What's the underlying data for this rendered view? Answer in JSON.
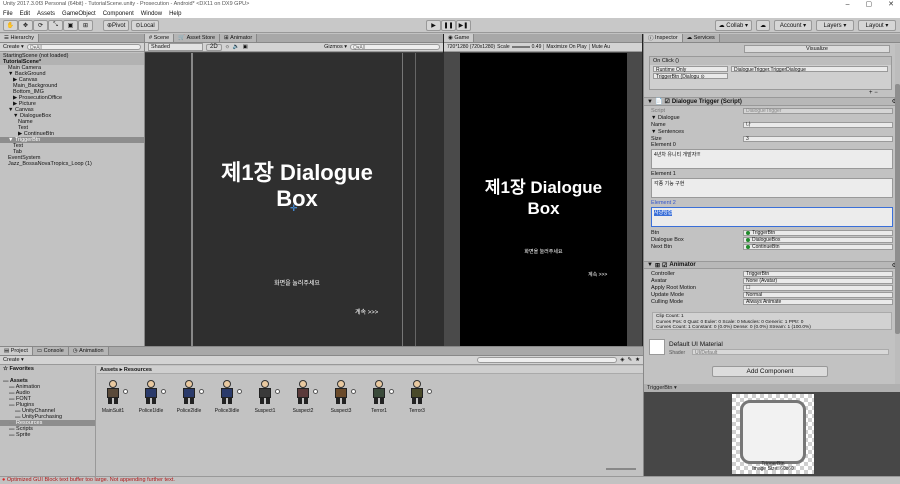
{
  "window": {
    "title": "Unity 2017.3.0f3 Personal (64bit) - TutorialScene.unity - Prosecution - Android* <DX11 on DX9 GPU>",
    "controls": [
      "–",
      "▢",
      "✕"
    ]
  },
  "menu": [
    "File",
    "Edit",
    "Assets",
    "GameObject",
    "Component",
    "Window",
    "Help"
  ],
  "toolbar": {
    "pivot": "Pivot",
    "local": "Local",
    "collab": "Collab ▾",
    "account": "Account ▾",
    "layers": "Layers ▾",
    "layout": "Layout ▾"
  },
  "hierarchy": {
    "tab": "Hierarchy",
    "create": "Create ▾",
    "search_placeholder": "Q▾All",
    "items": [
      {
        "label": "StartingScene (not loaded)",
        "indent": 0,
        "scene": true
      },
      {
        "label": "TutorialScene*",
        "indent": 0,
        "scene": true,
        "bold": true
      },
      {
        "label": "Main Camera",
        "indent": 1
      },
      {
        "label": "▼ BackGround",
        "indent": 1
      },
      {
        "label": "▶ Canvas",
        "indent": 2
      },
      {
        "label": "Main_Background",
        "indent": 2
      },
      {
        "label": "Bottom_IMG",
        "indent": 2
      },
      {
        "label": "▶ ProsecutionOffice",
        "indent": 2
      },
      {
        "label": "▶ Picture",
        "indent": 2
      },
      {
        "label": "▼ Canvas",
        "indent": 1
      },
      {
        "label": "▼ DialogueBox",
        "indent": 2
      },
      {
        "label": "Name",
        "indent": 3
      },
      {
        "label": "Text",
        "indent": 3
      },
      {
        "label": "▶ ContinueBtn",
        "indent": 3
      },
      {
        "label": "▼ TriggerBtn",
        "indent": 1,
        "selected": true
      },
      {
        "label": "Text",
        "indent": 2
      },
      {
        "label": "Tab",
        "indent": 2
      },
      {
        "label": "EventSystem",
        "indent": 1
      },
      {
        "label": "Jazz_BossaNovaTropics_Loop (1)",
        "indent": 1
      }
    ]
  },
  "scene": {
    "tabs": [
      "Scene",
      "Asset Store",
      "Animator"
    ],
    "shaded": "Shaded",
    "mode2d": "2D",
    "gizmos": "Gizmos ▾",
    "search": "Q▾All",
    "title_line1": "제1장 Dialogue",
    "title_line2": "Box",
    "prompt": "화면을 눌러주세요",
    "continue": "계속 >>>"
  },
  "game": {
    "tab": "Game",
    "resolution": "720*1280 (720x1280)",
    "scale_label": "Scale",
    "scale_value": "0.49",
    "maximize": "Maximize On Play",
    "mute": "Mute Au",
    "title_line1": "제1장 Dialogue",
    "title_line2": "Box",
    "prompt": "화면을 눌러주세요",
    "continue": "계속 >>>"
  },
  "project": {
    "tabs": [
      "Project",
      "Console",
      "Animation"
    ],
    "create": "Create ▾",
    "favorites": "Favorites",
    "tree": [
      {
        "label": "Assets",
        "indent": 0,
        "bold": true
      },
      {
        "label": "Animation",
        "indent": 1
      },
      {
        "label": "Audio",
        "indent": 1
      },
      {
        "label": "FONT",
        "indent": 1
      },
      {
        "label": "Plugins",
        "indent": 1
      },
      {
        "label": "UnityChannel",
        "indent": 2
      },
      {
        "label": "UnityPurchasing",
        "indent": 2
      },
      {
        "label": "Resources",
        "indent": 1,
        "selected": true
      },
      {
        "label": "Scripts",
        "indent": 1
      },
      {
        "label": "Sprite",
        "indent": 1
      }
    ],
    "breadcrumb": "Assets ▸ Resources",
    "assets": [
      "MainSuit1",
      "Police1Idle",
      "Police2Idle",
      "Police3Idle",
      "Suspect1",
      "Suspect2",
      "Suspect3",
      "Terror1",
      "Terror3"
    ]
  },
  "inspector": {
    "tabs": [
      "Inspector",
      "Services"
    ],
    "visualize": "Visualize",
    "onclick": "On Click ()",
    "runtime": "Runtime Only",
    "function": "DialogueTrigger.TriggerDialogue",
    "target": "TriggerBtn (Dialogu ⊙",
    "component_title": "Dialogue Trigger (Script)",
    "rows": [
      {
        "label": "Script",
        "value": "DialogueTrigger",
        "grey": true
      },
      {
        "label": "▼ Dialogue",
        "value": "",
        "nofield": true
      },
      {
        "label": "Name",
        "value": "나"
      },
      {
        "label": "▼ Sentences",
        "value": "",
        "nofield": true
      },
      {
        "label": "Size",
        "value": "3"
      }
    ],
    "elements": [
      {
        "label": "Element 0",
        "text": "4년차 유니티 개발자!!!"
      },
      {
        "label": "Element 1",
        "text": "각종 기능 구현"
      },
      {
        "label": "Element 2",
        "text": "사냥당함",
        "active": true
      }
    ],
    "refs": [
      {
        "label": "Btn",
        "value": "TriggerBtn"
      },
      {
        "label": "Dialogue Box",
        "value": "DialogueBox"
      },
      {
        "label": "Next Btn",
        "value": "ContinueBtn"
      }
    ],
    "animator_title": "Animator",
    "animator_rows": [
      {
        "label": "Controller",
        "value": "TriggerBtn"
      },
      {
        "label": "Avatar",
        "value": "None (Avatar)"
      },
      {
        "label": "Apply Root Motion",
        "value": "☐"
      },
      {
        "label": "Update Mode",
        "value": "Normal"
      },
      {
        "label": "Culling Mode",
        "value": "Always Animate"
      }
    ],
    "clip_info": [
      "Clip Count: 1",
      "Curves Pos: 0 Quat: 0 Euler: 0 Scale: 0 Muscles: 0 Generic: 1 PPtr: 0",
      "Curves Count: 1 Constant: 0 (0.0%) Dense: 0 (0.0%) Stream: 1 (100.0%)"
    ],
    "material": "Default UI Material",
    "shader_label": "Shader",
    "shader_value": "UI/Default",
    "add_component": "Add Component",
    "preview_tab": "TriggerBtn ▾",
    "preview_caption": "TriggerBtn\nImage Size: 60x60"
  },
  "status": {
    "error": "Optimized GUI Block text buffer too large. Not appending further text."
  }
}
